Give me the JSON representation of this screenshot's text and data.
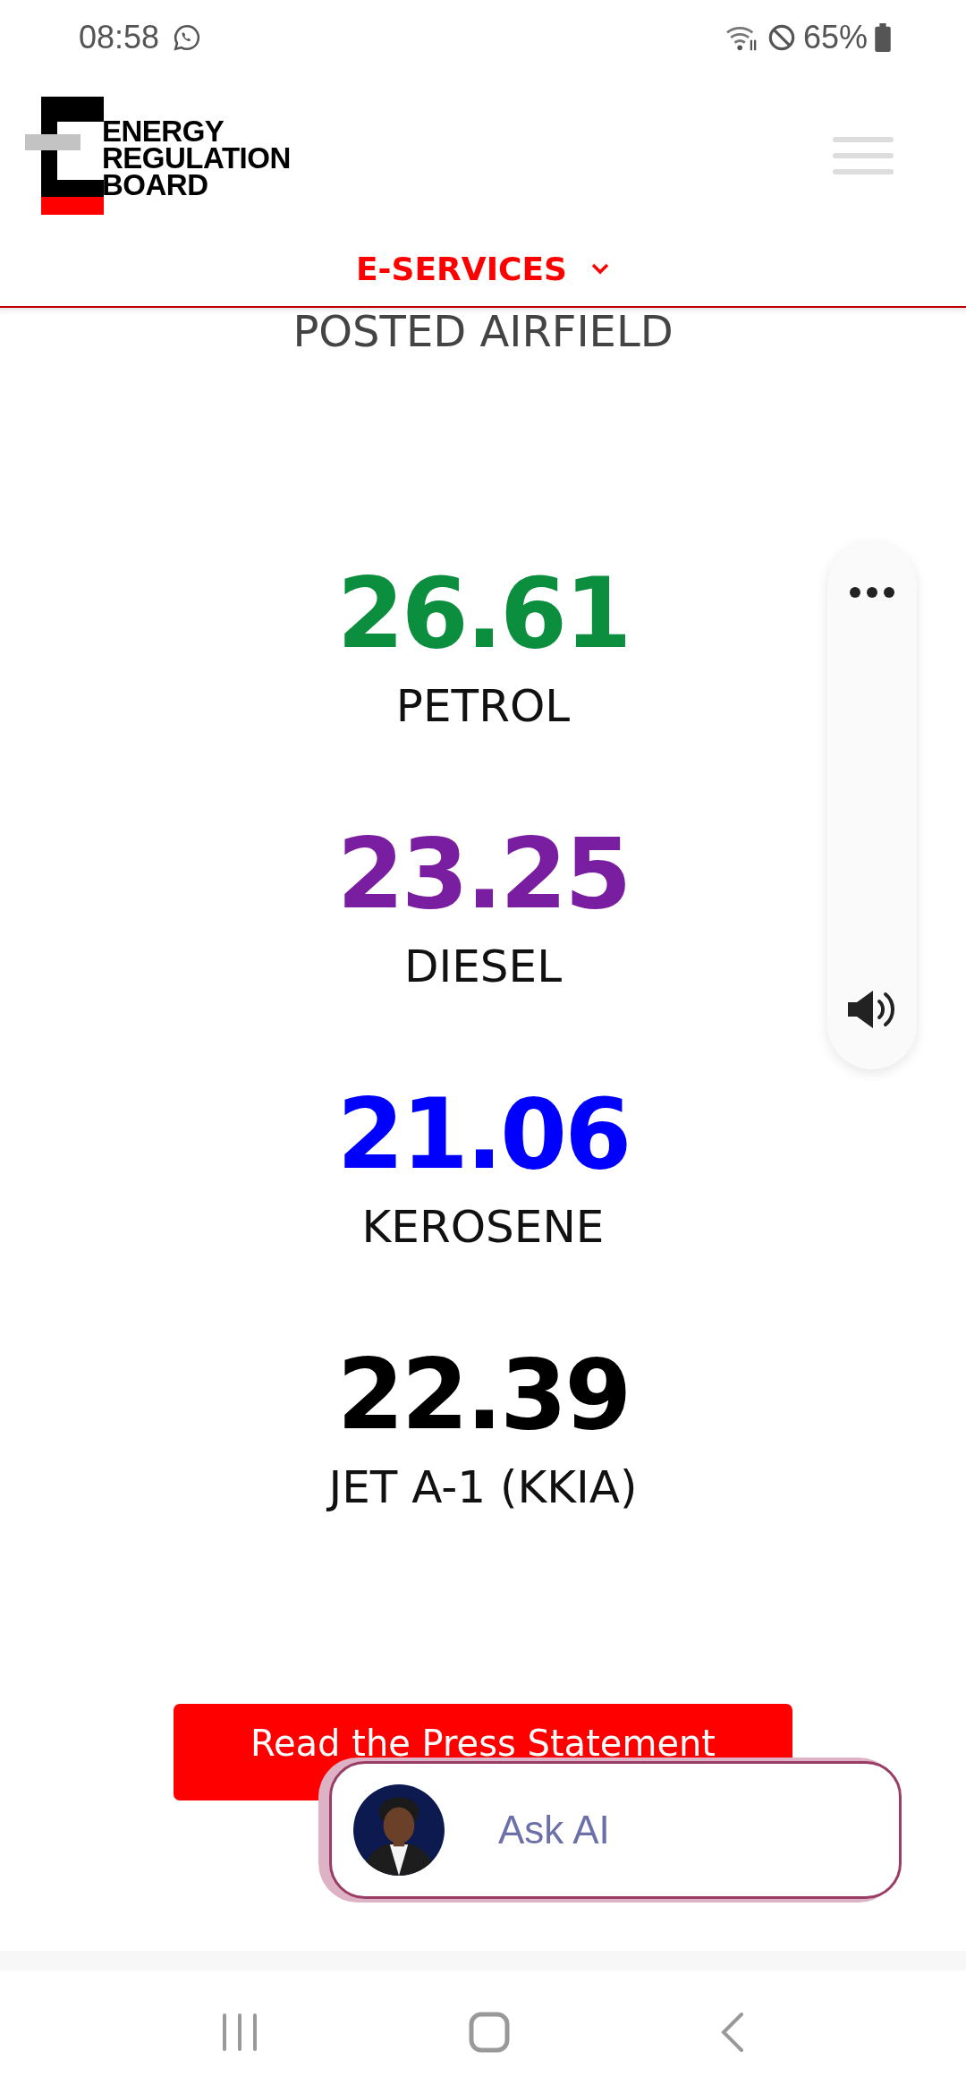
{
  "status_bar": {
    "time": "08:58",
    "battery": "65%"
  },
  "header": {
    "logo_lines": [
      "ENERGY",
      "REGULATION",
      "BOARD"
    ],
    "menu_label": "E-SERVICES"
  },
  "section_title": "POSTED AIRFIELD",
  "prices": [
    {
      "value": "26.61",
      "label": "PETROL",
      "color": "#0b8f3e"
    },
    {
      "value": "23.25",
      "label": "DIESEL",
      "color": "#7a1ea1"
    },
    {
      "value": "21.06",
      "label": "KEROSENE",
      "color": "#0000ff"
    },
    {
      "value": "22.39",
      "label": "JET A-1 (KKIA)",
      "color": "#000000"
    }
  ],
  "button": {
    "label": "Read the Press Statement"
  },
  "chat_widget": {
    "label": "Ask AI"
  }
}
